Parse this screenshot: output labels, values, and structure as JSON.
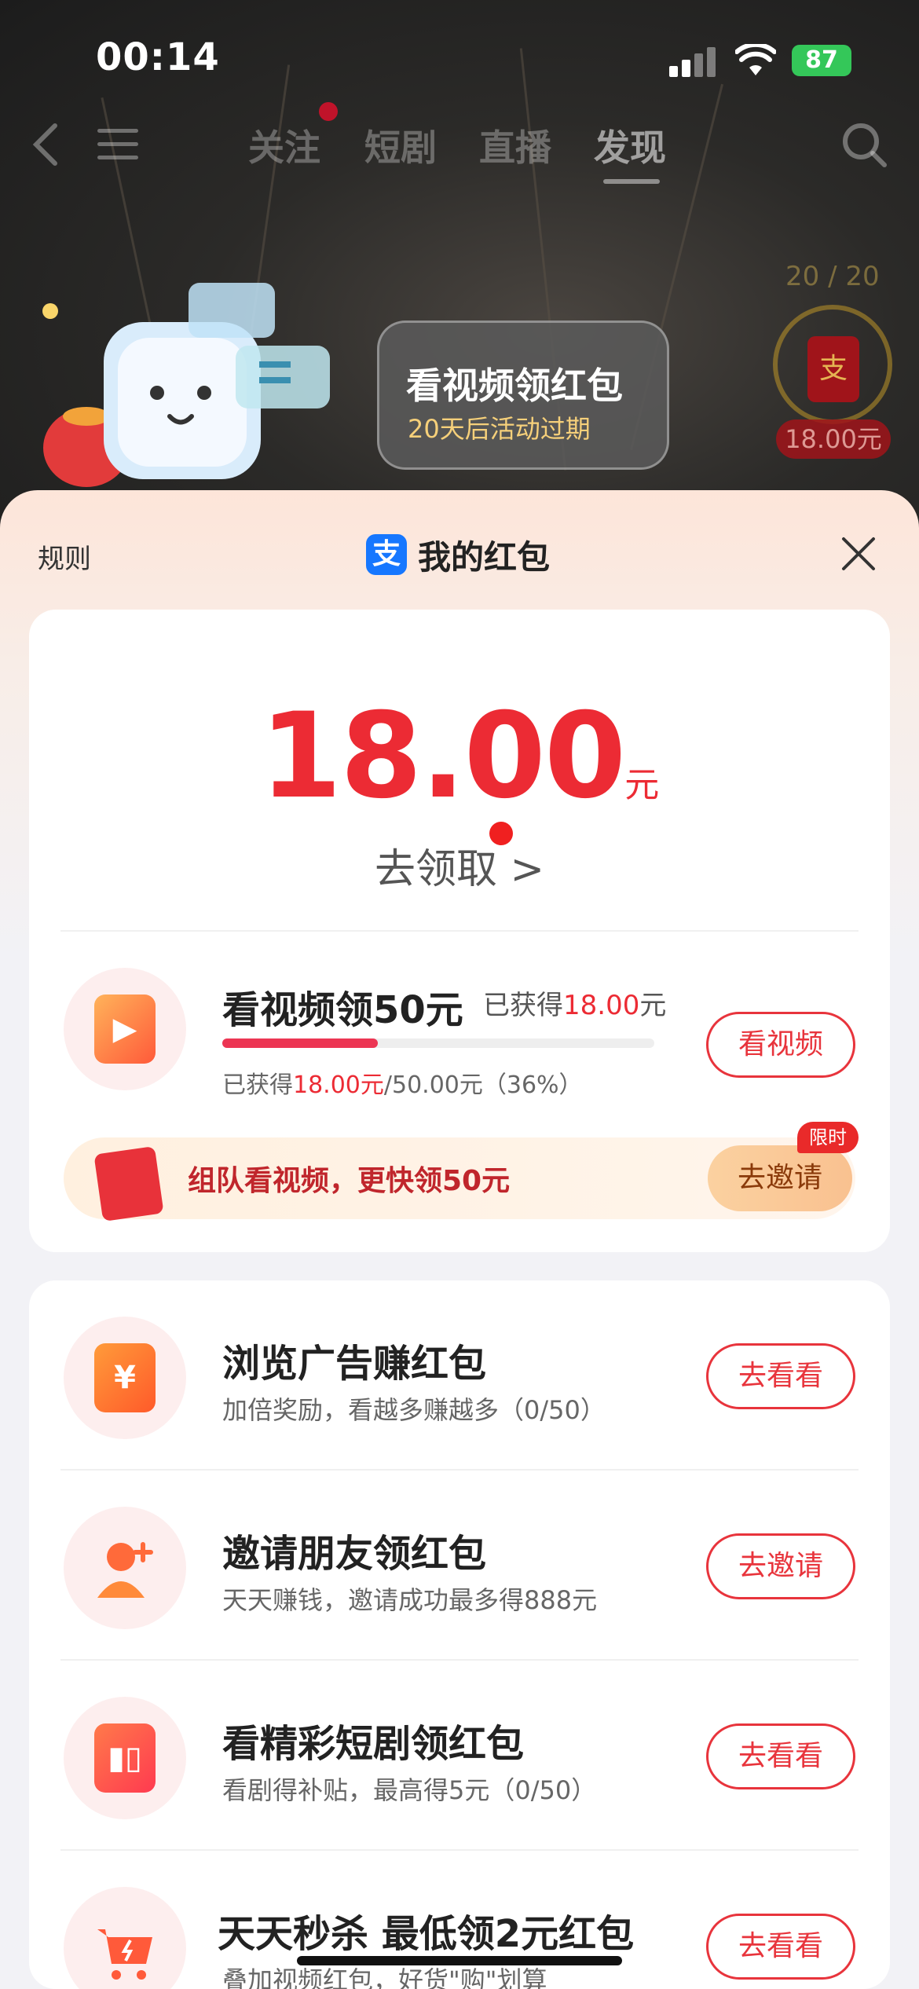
{
  "status_bar": {
    "time": "00:14",
    "battery": "87"
  },
  "nav": {
    "tabs": [
      "关注",
      "短剧",
      "直播",
      "发现"
    ],
    "active_tab": "发现"
  },
  "banner": {
    "title": "看视频领红包",
    "subtitle": "20天后活动过期",
    "counter": "20 / 20",
    "redbag_amount": "18.00元",
    "redbag_glyph": "支"
  },
  "sheet": {
    "rules": "规则",
    "logo_glyph": "支",
    "title": "我的红包",
    "amount": "18.00",
    "amount_unit": "元",
    "claim": "去领取 >"
  },
  "video_task": {
    "title": "看视频领50元",
    "earned_prefix": "已获得",
    "earned_value": "18.00",
    "earned_unit": "元",
    "progress_prefix": "已获得",
    "progress_value": "18.00元",
    "progress_rest": "/50.00元（36%）",
    "progress_fraction": 0.36,
    "button": "看视频"
  },
  "team": {
    "text": "组队看视频，更快领50元",
    "button": "去邀请",
    "badge": "限时"
  },
  "tasks": [
    {
      "title": "浏览广告赚红包",
      "subtitle": "加倍奖励，看越多赚越多（0/50）",
      "button": "去看看",
      "icon": "yen-ad-icon"
    },
    {
      "title": "邀请朋友领红包",
      "subtitle": "天天赚钱，邀请成功最多得888元",
      "button": "去邀请",
      "icon": "add-friend-icon"
    },
    {
      "title": "看精彩短剧领红包",
      "subtitle": "看剧得补贴，最高得5元（0/50）",
      "button": "去看看",
      "icon": "tv-drama-icon"
    },
    {
      "title": "天天秒杀 最低领2元红包",
      "subtitle": "叠加视频红包，好货\"购\"划算",
      "button": "去看看",
      "icon": "shopping-cart-icon"
    }
  ],
  "colors": {
    "accent": "#ec2b34",
    "battery": "#34c759",
    "alipay": "#1677ff"
  }
}
